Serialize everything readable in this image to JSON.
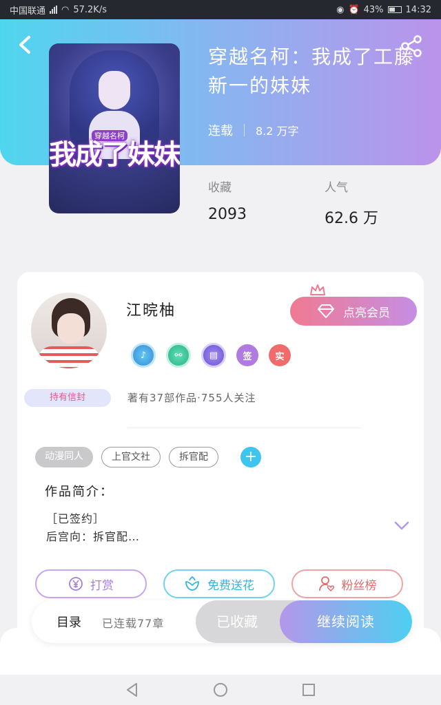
{
  "status": {
    "carrier": "中国联通",
    "net_speed": "57.2K/s",
    "battery": "43%",
    "time": "14:32"
  },
  "book": {
    "title": "穿越名柯：我成了工藤新一的妹妹",
    "status": "连载",
    "words": "8.2 万字",
    "cover_art_title": "我成了妹妹",
    "cover_art_small": "穿越名柯"
  },
  "stats": {
    "favorites_label": "收藏",
    "favorites_value": "2093",
    "popularity_label": "人气",
    "popularity_value": "62.6 万"
  },
  "author": {
    "name": "江晥柚",
    "vip_label": "点亮会员",
    "holder_badge": "持有信封",
    "badges": [
      "music-badge",
      "handshake-badge",
      "calendar-badge",
      "签",
      "实"
    ],
    "summary": "著有37部作品·755人关注"
  },
  "tags": [
    "动漫同人",
    "上官文社",
    "拆官配"
  ],
  "intro": {
    "label": "作品简介：",
    "line1": "［已签约］",
    "line2": "后宫向：拆官配…"
  },
  "actions": {
    "reward": "打赏",
    "flower": "免费送花",
    "fans": "粉丝榜"
  },
  "bottom": {
    "toc": "目录",
    "toc_count": "已连载77章",
    "collected": "已收藏",
    "continue": "继续阅读"
  },
  "colors": {
    "header_start": "#4fd6ef",
    "header_end": "#bb93ea",
    "accent_blue": "#3fc3ef",
    "accent_purple": "#b497ea"
  }
}
